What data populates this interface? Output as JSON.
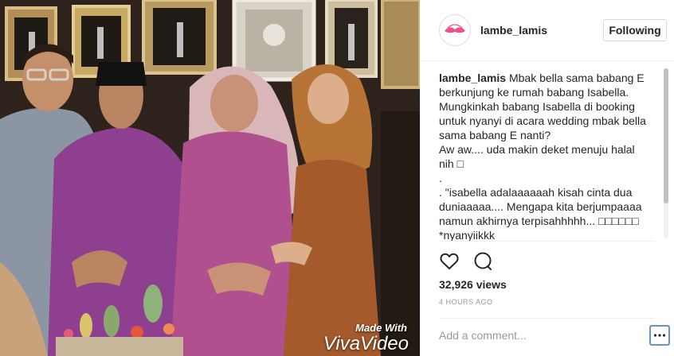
{
  "post": {
    "username": "lambe_lamis",
    "follow_label": "Following",
    "caption": {
      "username": "lambe_lamis",
      "lines": [
        "Mbak bella sama babang E berkunjung ke rumah babang Isabella.",
        "Mungkinkah babang Isabella di booking untuk nyanyi di acara wedding mbak bella sama babang E nanti?",
        "Aw aw.... uda makin deket menuju halal nih □",
        ".",
        ". \"isabella adalaaaaaah kisah cinta dua duniaaaaa.... Mengapa kita berjumpaaaa namun akhirnya terpisahhhhh... □□□□□□ *nyanyiikkk"
      ]
    },
    "views": "32,926 views",
    "time_ago": "4 HOURS AGO",
    "comment_placeholder": "Add a comment...",
    "watermark": {
      "top": "Made With",
      "brand": "VivaVideo"
    }
  },
  "icons": {
    "like": "heart-icon",
    "comment": "comment-bubble-icon",
    "more": "more-options-icon"
  },
  "colors": {
    "accent_pink": "#e7528f",
    "more_border": "#6b8fd1",
    "muted": "#999999"
  }
}
